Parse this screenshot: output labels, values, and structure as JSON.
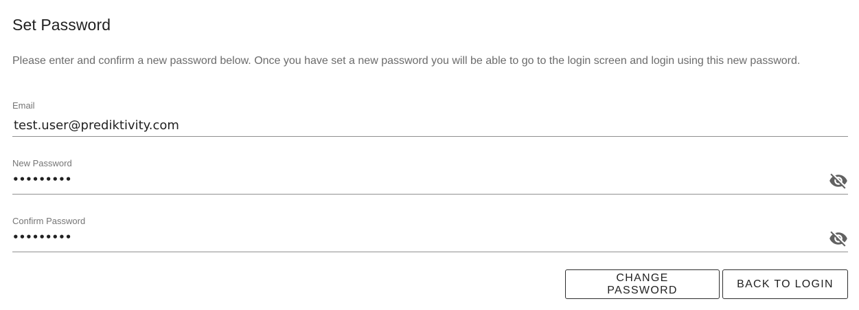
{
  "page": {
    "title": "Set Password",
    "description": "Please enter and confirm a new password below. Once you have set a new password you will be able to go to the login screen and login using this new password."
  },
  "form": {
    "email": {
      "label": "Email",
      "value": "test.user@prediktivity.com"
    },
    "new_password": {
      "label": "New Password",
      "value": "•••••••••",
      "toggle_icon": "eye-off-icon"
    },
    "confirm_password": {
      "label": "Confirm Password",
      "value": "•••••••••",
      "toggle_icon": "eye-off-icon"
    }
  },
  "actions": {
    "change_password_label": "CHANGE PASSWORD",
    "back_to_login_label": "BACK TO LOGIN"
  },
  "colors": {
    "text": "#212121",
    "muted": "#6b6b6b",
    "border": "#8f8f8f",
    "icon": "#616161"
  }
}
